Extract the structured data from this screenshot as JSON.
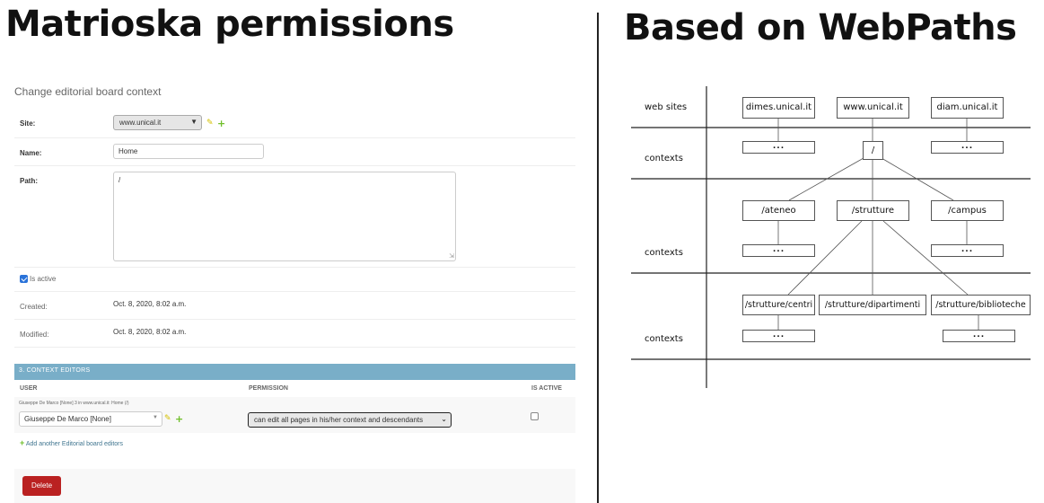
{
  "titles": {
    "left": "Matrioska permissions",
    "right": "Based on WebPaths"
  },
  "form": {
    "heading": "Change editorial board context",
    "site_label": "Site:",
    "site_value": "www.unical.it",
    "name_label": "Name:",
    "name_value": "Home",
    "path_label": "Path:",
    "path_value": "/",
    "is_active_label": "Is active",
    "is_active_checked": true,
    "created_label": "Created:",
    "created_value": "Oct. 8, 2020, 8:02 a.m.",
    "modified_label": "Modified:",
    "modified_value": "Oct. 8, 2020, 8:02 a.m."
  },
  "inline": {
    "header": "3. CONTEXT EDITORS",
    "columns": {
      "user": "USER",
      "permission": "PERMISSION",
      "is_active": "IS ACTIVE"
    },
    "object_label": "Giuseppe De Marco [None] 3 in www.unical.it: Home (/)",
    "user_value": "Giuseppe De Marco [None]",
    "permission_value": "can edit all pages in his/her context and descendants",
    "is_active_checked": false,
    "add_another": "Add another Editorial board editors"
  },
  "actions": {
    "delete": "Delete"
  },
  "icons": {
    "pencil": "pencil-icon",
    "plus": "plus-icon",
    "chevron": "chevron-down-icon"
  },
  "colors": {
    "inline_header": "#79aec8",
    "delete": "#ba2121",
    "add": "#70bf2b",
    "link": "#417690"
  },
  "diagram": {
    "row_labels": {
      "web_sites": "web sites",
      "contexts1": "contexts",
      "contexts2": "contexts",
      "contexts3": "contexts"
    },
    "sites": {
      "dimes": "dimes.unical.it",
      "www": "www.unical.it",
      "diam": "diam.unical.it"
    },
    "ellipsis": "...",
    "root": "/",
    "ctx2": {
      "ateneo": "/ateneo",
      "strutture": "/strutture",
      "campus": "/campus"
    },
    "ctx3": {
      "centri": "/strutture/centri",
      "dipartimenti": "/strutture/dipartimenti",
      "biblioteche": "/strutture/biblioteche"
    }
  }
}
